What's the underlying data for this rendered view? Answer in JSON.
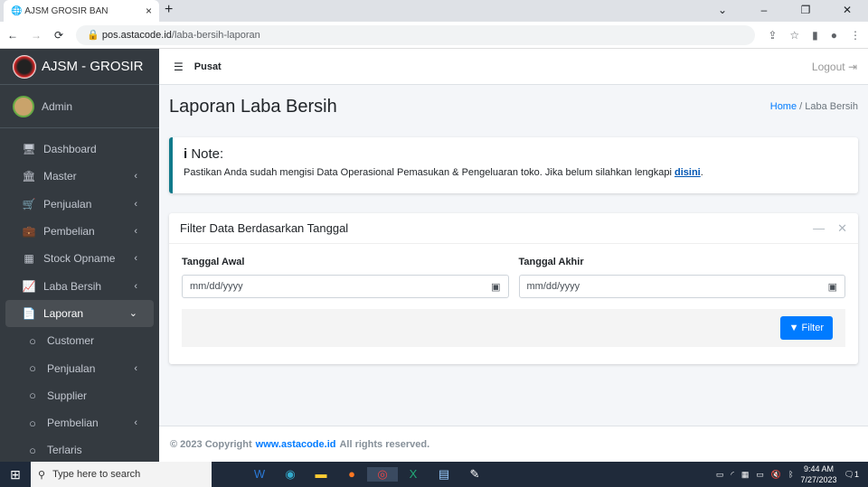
{
  "browser": {
    "tab_title": "AJSM GROSIR BAN",
    "url_host": "pos.astacode.id",
    "url_path": "/laba-bersih-laporan"
  },
  "sidebar": {
    "brand": "AJSM - GROSIR",
    "user": "Admin",
    "items": [
      {
        "label": "Dashboard",
        "icon": "🖥",
        "chev": ""
      },
      {
        "label": "Master",
        "icon": "🏛",
        "chev": "‹"
      },
      {
        "label": "Penjualan",
        "icon": "🛒",
        "chev": "‹"
      },
      {
        "label": "Pembelian",
        "icon": "💼",
        "chev": "‹"
      },
      {
        "label": "Stock Opname",
        "icon": "▦",
        "chev": "‹"
      },
      {
        "label": "Laba Bersih",
        "icon": "📈",
        "chev": "‹"
      },
      {
        "label": "Laporan",
        "icon": "📄",
        "chev": "⌄"
      },
      {
        "label": "Customer",
        "icon": "○",
        "chev": ""
      },
      {
        "label": "Penjualan",
        "icon": "○",
        "chev": "‹"
      },
      {
        "label": "Supplier",
        "icon": "○",
        "chev": ""
      },
      {
        "label": "Pembelian",
        "icon": "○",
        "chev": "‹"
      },
      {
        "label": "Terlaris",
        "icon": "○",
        "chev": ""
      }
    ]
  },
  "topnav": {
    "branch": "Pusat",
    "logout": "Logout"
  },
  "page": {
    "title": "Laporan Laba Bersih",
    "breadcrumb_home": "Home",
    "breadcrumb_sep": "/",
    "breadcrumb_current": "Laba Bersih"
  },
  "note": {
    "title": "Note:",
    "text": "Pastikan Anda sudah mengisi Data Operasional Pemasukan & Pengeluaran toko. Jika belum silahkan lengkapi ",
    "link": "disini",
    "end": "."
  },
  "filter": {
    "title": "Filter Data Berdasarkan Tanggal",
    "start_label": "Tanggal Awal",
    "end_label": "Tanggal Akhir",
    "placeholder": "mm/dd/yyyy",
    "button": "Filter"
  },
  "footer": {
    "prefix": "© 2023 Copyright",
    "link": "www.astacode.id",
    "suffix": "All rights reserved."
  },
  "taskbar": {
    "search": "Type here to search",
    "time": "9:44 AM",
    "date": "7/27/2023",
    "notifications": "1"
  }
}
